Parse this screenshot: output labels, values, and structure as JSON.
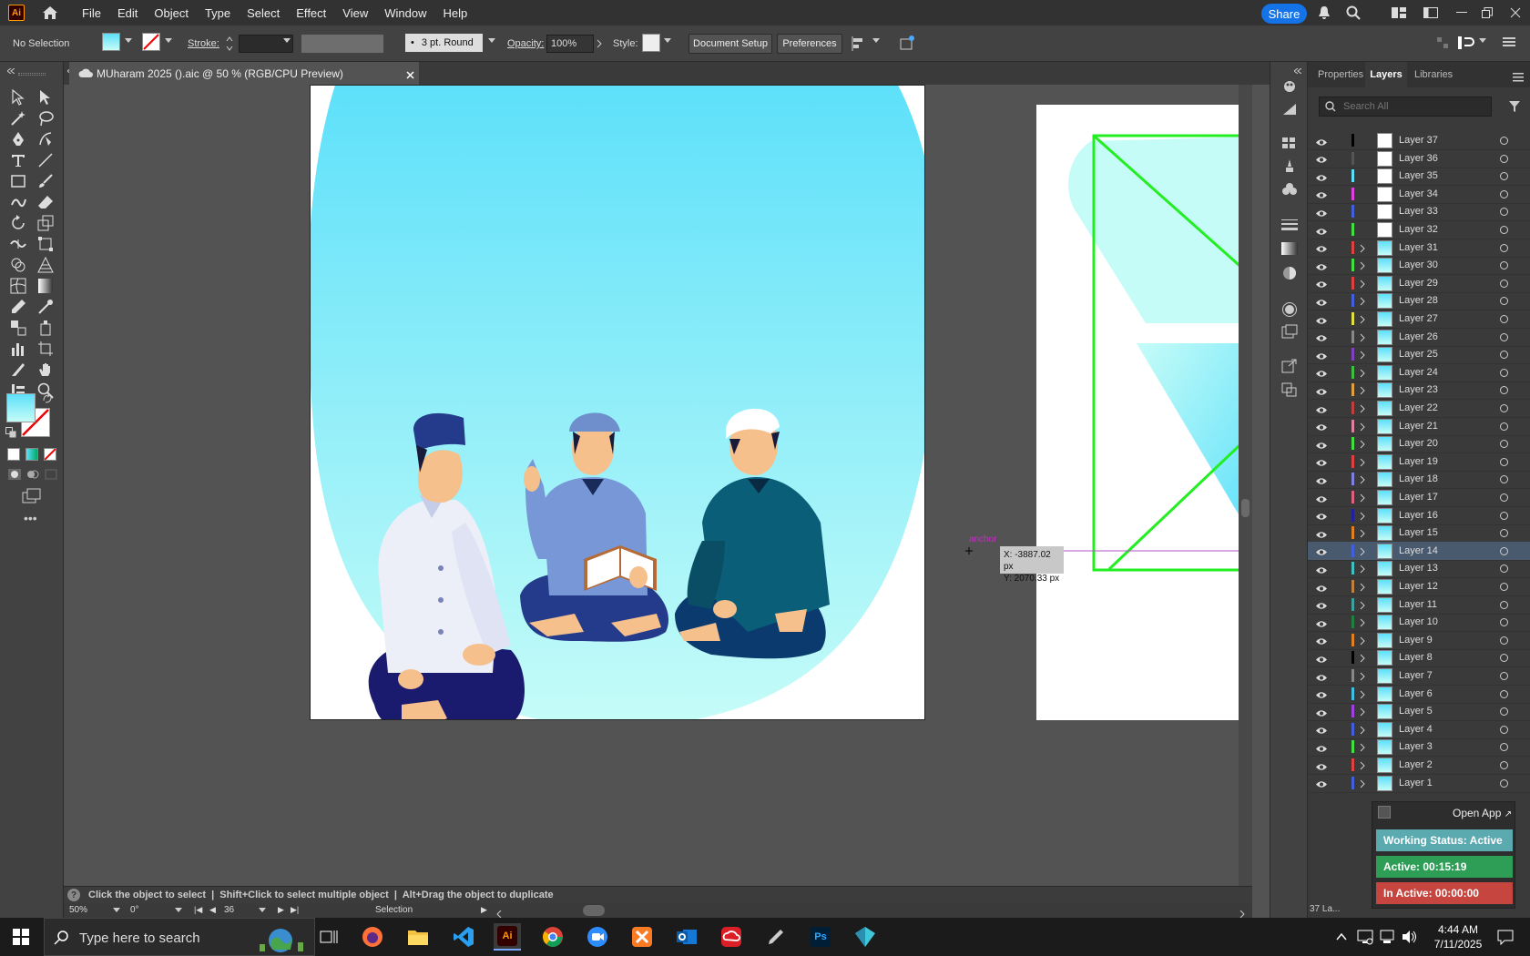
{
  "app": {
    "logo": "Ai",
    "menus": [
      "File",
      "Edit",
      "Object",
      "Type",
      "Select",
      "Effect",
      "View",
      "Window",
      "Help"
    ],
    "share_label": "Share"
  },
  "control": {
    "selection": "No Selection",
    "stroke_label": "Stroke:",
    "brush_label": "3 pt. Round",
    "opacity_label": "Opacity:",
    "opacity_value": "100%",
    "style_label": "Style:",
    "doc_setup": "Document Setup",
    "preferences": "Preferences"
  },
  "document": {
    "tab_title": "MUharam 2025 ().aic @ 50 % (RGB/CPU Preview)",
    "fill_color": "#5ce0fa"
  },
  "canvas": {
    "anchor_label": "anchor",
    "x_readout": "X: -3887.02 px",
    "y_readout": "Y: 2070.33 px"
  },
  "status": {
    "hint": "Click the object to select  |  Shift+Click to select multiple object  |  Alt+Drag the object to duplicate",
    "zoom": "50%",
    "rotation": "0°",
    "artboard_num": "36",
    "mode": "Selection",
    "layer_count": "37 La..."
  },
  "panel": {
    "tabs": [
      "Properties",
      "Layers",
      "Libraries"
    ],
    "active_tab": "Layers",
    "search_placeholder": "Search All"
  },
  "layers": [
    {
      "name": "Layer 37",
      "color": "#000000"
    },
    {
      "name": "Layer 36",
      "color": "#555555"
    },
    {
      "name": "Layer 35",
      "color": "#5ce0fa"
    },
    {
      "name": "Layer 34",
      "color": "#e040e0"
    },
    {
      "name": "Layer 33",
      "color": "#4060e0"
    },
    {
      "name": "Layer 32",
      "color": "#40e040"
    },
    {
      "name": "Layer 31",
      "color": "#e04040"
    },
    {
      "name": "Layer 30",
      "color": "#40e040"
    },
    {
      "name": "Layer 29",
      "color": "#e04040"
    },
    {
      "name": "Layer 28",
      "color": "#4060e0"
    },
    {
      "name": "Layer 27",
      "color": "#e0e040"
    },
    {
      "name": "Layer 26",
      "color": "#888888"
    },
    {
      "name": "Layer 25",
      "color": "#8040c0"
    },
    {
      "name": "Layer 24",
      "color": "#40c040"
    },
    {
      "name": "Layer 23",
      "color": "#e0a040"
    },
    {
      "name": "Layer 22",
      "color": "#c04040"
    },
    {
      "name": "Layer 21",
      "color": "#e080a0"
    },
    {
      "name": "Layer 20",
      "color": "#40e040"
    },
    {
      "name": "Layer 19",
      "color": "#e04040"
    },
    {
      "name": "Layer 18",
      "color": "#8080e0"
    },
    {
      "name": "Layer 17",
      "color": "#e06080"
    },
    {
      "name": "Layer 16",
      "color": "#2020a0"
    },
    {
      "name": "Layer 15",
      "color": "#e08020"
    },
    {
      "name": "Layer 14",
      "color": "#4060e0"
    },
    {
      "name": "Layer 13",
      "color": "#40c0c0"
    },
    {
      "name": "Layer 12",
      "color": "#c08040"
    },
    {
      "name": "Layer 11",
      "color": "#40a0a0"
    },
    {
      "name": "Layer 10",
      "color": "#208040"
    },
    {
      "name": "Layer 9",
      "color": "#e08020"
    },
    {
      "name": "Layer 8",
      "color": "#000000"
    },
    {
      "name": "Layer 7",
      "color": "#888888"
    },
    {
      "name": "Layer 6",
      "color": "#40c0e0"
    },
    {
      "name": "Layer 5",
      "color": "#a040e0"
    },
    {
      "name": "Layer 4",
      "color": "#4060e0"
    },
    {
      "name": "Layer 3",
      "color": "#40e040"
    },
    {
      "name": "Layer 2",
      "color": "#e04040"
    },
    {
      "name": "Layer 1",
      "color": "#4060e0"
    }
  ],
  "selected_layer": "Layer 14",
  "widget": {
    "open_app": "Open App",
    "status": "Working Status: Active",
    "active": "Active: 00:15:19",
    "inactive": "In Active: 00:00:00"
  },
  "taskbar": {
    "search_placeholder": "Type here to search",
    "time": "4:44 AM",
    "date": "7/11/2025"
  }
}
